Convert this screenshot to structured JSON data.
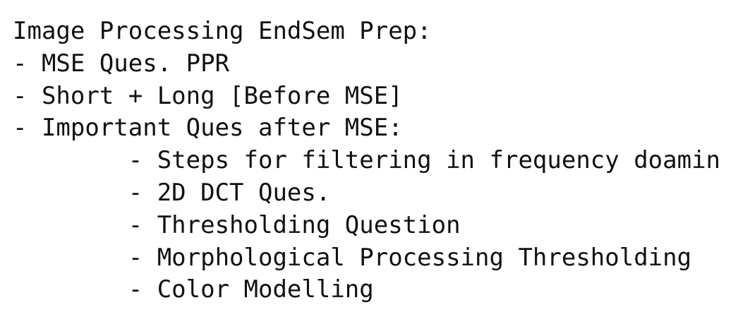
{
  "document": {
    "lines": [
      "Image Processing EndSem Prep:",
      "- MSE Ques. PPR",
      "- Short + Long [Before MSE]",
      "- Important Ques after MSE:",
      "        - Steps for filtering in frequency doamin",
      "        - 2D DCT Ques.",
      "        - Thresholding Question",
      "        - Morphological Processing Thresholding",
      "        - Color Modelling"
    ]
  }
}
